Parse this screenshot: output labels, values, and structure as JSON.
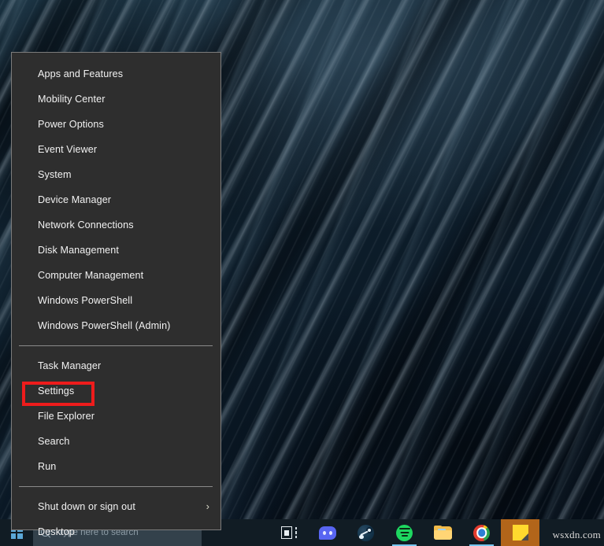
{
  "desktop": {
    "wallpaper_description": "dark blue ocean water with diagonal wave ripples",
    "wallpaper_colors": [
      "#18303f",
      "#0d1d2a",
      "#060f1a"
    ]
  },
  "winx_menu": {
    "groups": [
      {
        "items": [
          {
            "label": "Apps and Features",
            "name": "menu-item-apps-and-features"
          },
          {
            "label": "Mobility Center",
            "name": "menu-item-mobility-center"
          },
          {
            "label": "Power Options",
            "name": "menu-item-power-options"
          },
          {
            "label": "Event Viewer",
            "name": "menu-item-event-viewer"
          },
          {
            "label": "System",
            "name": "menu-item-system"
          },
          {
            "label": "Device Manager",
            "name": "menu-item-device-manager"
          },
          {
            "label": "Network Connections",
            "name": "menu-item-network-connections"
          },
          {
            "label": "Disk Management",
            "name": "menu-item-disk-management"
          },
          {
            "label": "Computer Management",
            "name": "menu-item-computer-management"
          },
          {
            "label": "Windows PowerShell",
            "name": "menu-item-windows-powershell"
          },
          {
            "label": "Windows PowerShell (Admin)",
            "name": "menu-item-windows-powershell-admin"
          }
        ]
      },
      {
        "items": [
          {
            "label": "Task Manager",
            "name": "menu-item-task-manager"
          },
          {
            "label": "Settings",
            "name": "menu-item-settings",
            "highlighted": true
          },
          {
            "label": "File Explorer",
            "name": "menu-item-file-explorer"
          },
          {
            "label": "Search",
            "name": "menu-item-search"
          },
          {
            "label": "Run",
            "name": "menu-item-run"
          }
        ]
      },
      {
        "items": [
          {
            "label": "Shut down or sign out",
            "name": "menu-item-shut-down-or-sign-out",
            "submenu": true,
            "chevron": "›"
          },
          {
            "label": "Desktop",
            "name": "menu-item-desktop"
          }
        ]
      }
    ],
    "highlight_color": "#ee1c1c",
    "background_color": "#2e2e2e",
    "border_color": "#7c7c7c"
  },
  "taskbar": {
    "background_color": "#111c24",
    "start_button": {
      "icon": "windows-logo-icon",
      "label": "Start"
    },
    "search": {
      "placeholder": "Type here to search",
      "icon": "search-icon"
    },
    "buttons": [
      {
        "name": "taskbar-task-view-button",
        "icon": "task-view-icon",
        "label": "Task View",
        "running": false
      },
      {
        "name": "taskbar-discord-button",
        "icon": "discord-icon",
        "label": "Discord",
        "running": false
      },
      {
        "name": "taskbar-steam-button",
        "icon": "steam-icon",
        "label": "Steam",
        "running": false
      },
      {
        "name": "taskbar-spotify-button",
        "icon": "spotify-icon",
        "label": "Spotify",
        "running": true
      },
      {
        "name": "taskbar-file-explorer-button",
        "icon": "folder-icon",
        "label": "File Explorer",
        "running": false
      },
      {
        "name": "taskbar-chrome-button",
        "icon": "chrome-icon",
        "label": "Google Chrome",
        "running": true
      },
      {
        "name": "taskbar-sticky-notes-button",
        "icon": "sticky-note-icon",
        "label": "Sticky Notes",
        "running": true,
        "active": true
      }
    ]
  },
  "watermark": {
    "text": "wsxdn.com"
  }
}
